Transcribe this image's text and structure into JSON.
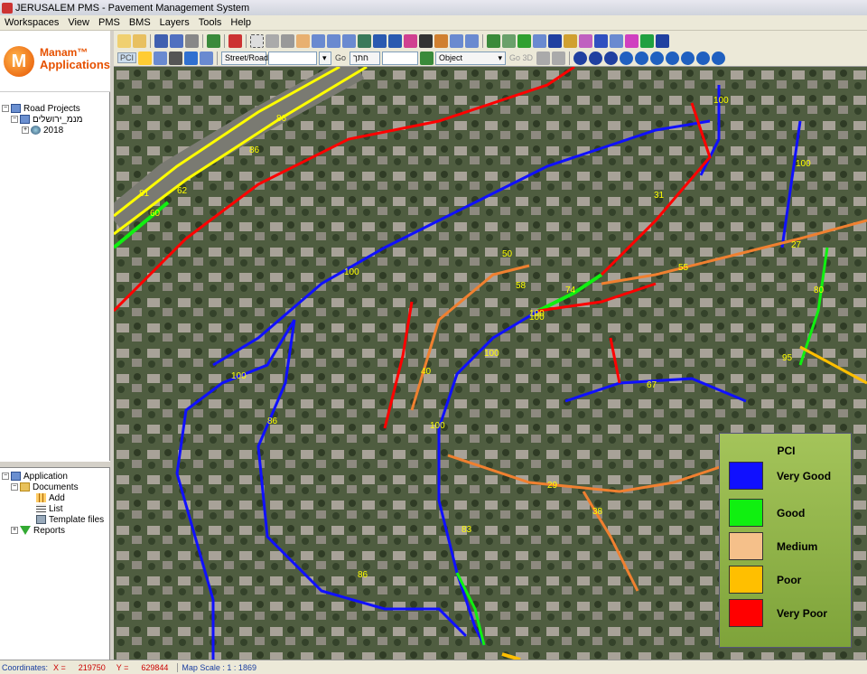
{
  "window": {
    "title": "JERUSALEM PMS - Pavement Management System"
  },
  "menu": [
    "Workspaces",
    "View",
    "PMS",
    "BMS",
    "Layers",
    "Tools",
    "Help"
  ],
  "logo": {
    "line1": "Manam™",
    "line2": "Applications"
  },
  "tree_top": {
    "root": "Road Projects",
    "child": "מנמ_ירושלים",
    "year": "2018"
  },
  "tree_bottom": {
    "root": "Application",
    "documents": "Documents",
    "add": "Add",
    "list": "List",
    "templates": "Template files",
    "reports": "Reports"
  },
  "toolbar": {
    "pci": "PCI",
    "street_drop": "Street/Road",
    "go1": "Go",
    "search_drop": "חתך",
    "object_drop": "Object",
    "go3d": "Go 3D"
  },
  "legend": {
    "title": "PCI",
    "items": [
      {
        "label": "Very Good",
        "color": "#1010ff"
      },
      {
        "label": "Good",
        "color": "#10f010"
      },
      {
        "label": "Medium",
        "color": "#f5c08a"
      },
      {
        "label": "Poor",
        "color": "#ffbf00"
      },
      {
        "label": "Very Poor",
        "color": "#ff0000"
      }
    ]
  },
  "map_labels": {
    "blue": [
      "100",
      "100",
      "86",
      "100",
      "100",
      "100",
      "83",
      "86",
      "100",
      "67",
      "100"
    ],
    "red": [
      "40",
      "31",
      "100"
    ],
    "orange": [
      "55",
      "27",
      "29",
      "38",
      "50",
      "58"
    ],
    "yellow": [
      "86",
      "86",
      "62",
      "60",
      "95"
    ],
    "green": [
      "81",
      "74",
      "80"
    ]
  },
  "status": {
    "coords_label": "Coordinates:",
    "x_label": "X =",
    "x_value": "219750",
    "y_label": "Y =",
    "y_value": "629844",
    "scale": "Map Scale : 1 : 1869"
  }
}
